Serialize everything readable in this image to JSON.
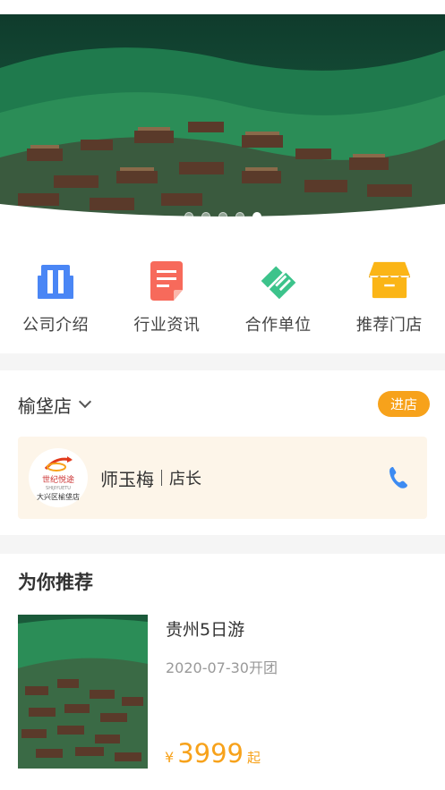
{
  "banner": {
    "slide_count": 5,
    "active_index": 4
  },
  "menu": {
    "items": [
      {
        "label": "公司介绍",
        "icon": "building-icon",
        "color": "#4a86f5"
      },
      {
        "label": "行业资讯",
        "icon": "document-icon",
        "color": "#f76a5b"
      },
      {
        "label": "合作单位",
        "icon": "handshake-icon",
        "color": "#3cc38b"
      },
      {
        "label": "推荐门店",
        "icon": "storefront-icon",
        "color": "#fbb516"
      }
    ]
  },
  "store": {
    "name": "榆垡店",
    "enter_label": "进店",
    "logo_brand": "世纪悦途",
    "logo_sub": "SHIJIYUETU",
    "logo_branch": "大兴区榆垡店",
    "manager_name": "师玉梅",
    "manager_role": "店长",
    "accent": "#f7a21b"
  },
  "recommend": {
    "title": "为你推荐",
    "items": [
      {
        "title": "贵州5日游",
        "date": "2020-07-30开团",
        "currency": "¥",
        "price": "3999",
        "price_suffix": "起"
      }
    ]
  }
}
